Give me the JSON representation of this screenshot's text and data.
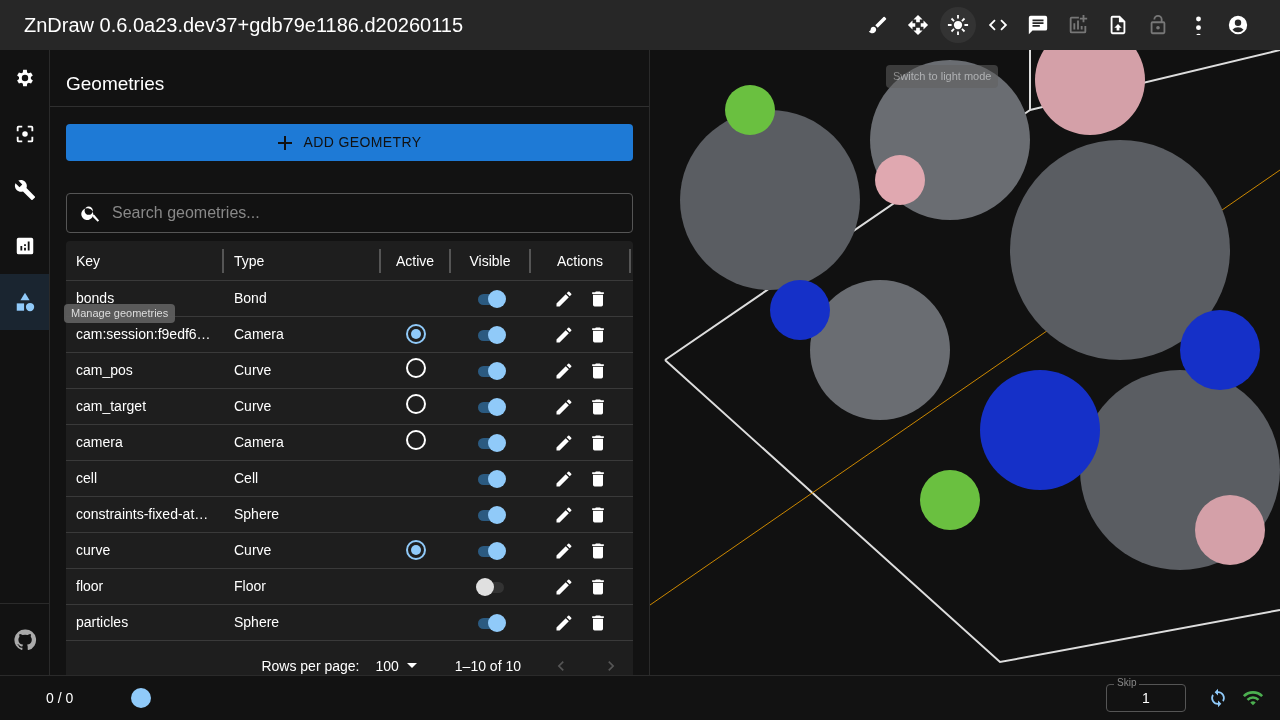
{
  "app_title": "ZnDraw 0.6.0a23.dev37+gdb79e1186.d20260115",
  "toolbar": [
    {
      "kind": "brush",
      "disabled": false
    },
    {
      "kind": "move",
      "disabled": false
    },
    {
      "kind": "sun",
      "disabled": false,
      "tooltip": "Switch to light mode"
    },
    {
      "kind": "code",
      "disabled": false
    },
    {
      "kind": "chat",
      "disabled": false
    },
    {
      "kind": "chart-add",
      "disabled": true
    },
    {
      "kind": "upload",
      "disabled": false
    },
    {
      "kind": "lock",
      "disabled": true
    },
    {
      "kind": "more",
      "disabled": false
    },
    {
      "kind": "account",
      "disabled": false
    }
  ],
  "sidebar": {
    "items": [
      {
        "kind": "settings",
        "selected": false
      },
      {
        "kind": "focus",
        "selected": false
      },
      {
        "kind": "wrench",
        "selected": false
      },
      {
        "kind": "analytics",
        "selected": false
      },
      {
        "kind": "shapes",
        "selected": true,
        "tooltip": "Manage geometries"
      }
    ],
    "footer": {
      "kind": "github"
    }
  },
  "panel": {
    "title": "Geometries",
    "add_button": "ADD GEOMETRY",
    "search": {
      "placeholder": "Search geometries..."
    },
    "table": {
      "columns": [
        "Key",
        "Type",
        "Active",
        "Visible",
        "Actions"
      ],
      "rows": [
        {
          "key": "bonds",
          "type": "Bond",
          "visible": true
        },
        {
          "key": "cam:session:f9edf6…",
          "type": "Camera",
          "active": true,
          "visible": true
        },
        {
          "key": "cam_pos",
          "type": "Curve",
          "active": false,
          "visible": true
        },
        {
          "key": "cam_target",
          "type": "Curve",
          "active": false,
          "visible": true
        },
        {
          "key": "camera",
          "type": "Camera",
          "active": false,
          "visible": true
        },
        {
          "key": "cell",
          "type": "Cell",
          "visible": true
        },
        {
          "key": "constraints-fixed-at…",
          "type": "Sphere",
          "visible": true
        },
        {
          "key": "curve",
          "type": "Curve",
          "active": true,
          "visible": true
        },
        {
          "key": "floor",
          "type": "Floor",
          "visible": false
        },
        {
          "key": "particles",
          "type": "Sphere",
          "visible": true
        }
      ],
      "pagination": {
        "rows_label": "Rows per page:",
        "rows_value": "100",
        "range": "1–10 of 10"
      }
    }
  },
  "bottom_bar": {
    "frame": "0 / 0",
    "skip": {
      "label": "Skip",
      "value": "1"
    }
  }
}
